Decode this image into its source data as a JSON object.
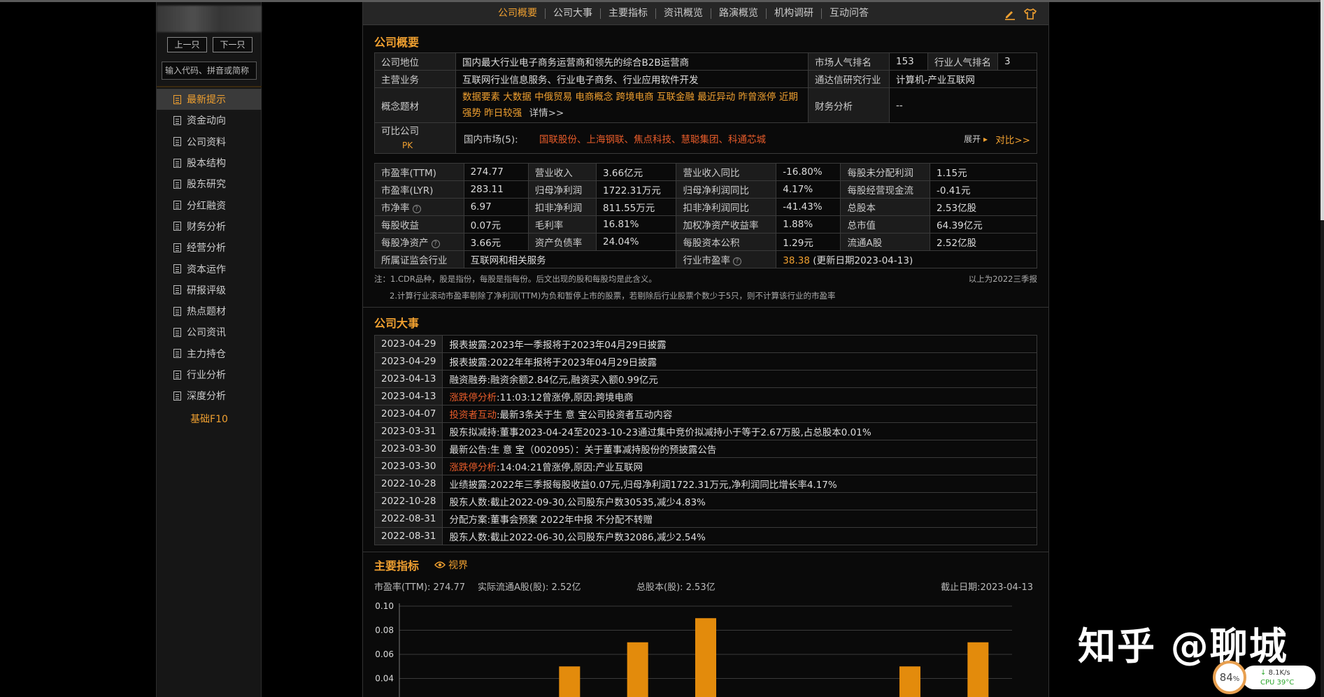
{
  "sidebar": {
    "prev_label": "上一只",
    "next_label": "下一只",
    "search_placeholder": "输入代码、拼音或简称",
    "items": [
      "最新提示",
      "资金动向",
      "公司资料",
      "股本结构",
      "股东研究",
      "分红融资",
      "财务分析",
      "经营分析",
      "资本运作",
      "研报评级",
      "热点题材",
      "公司资讯",
      "主力持仓",
      "行业分析",
      "深度分析"
    ],
    "active_index": 0,
    "basic_f10": "基础F10"
  },
  "topnav": {
    "tabs": [
      "公司概要",
      "公司大事",
      "主要指标",
      "资讯概览",
      "路演概览",
      "机构调研",
      "互动问答"
    ],
    "active_index": 0,
    "icons": [
      "edit-icon",
      "shirt-icon"
    ]
  },
  "profile": {
    "title": "公司概要",
    "position_label": "公司地位",
    "position_value": "国内最大行业电子商务运营商和领先的综合B2B运营商",
    "market_rank_label": "市场人气排名",
    "market_rank_value": "153",
    "industry_rank_label": "行业人气排名",
    "industry_rank_value": "3",
    "business_label": "主营业务",
    "business_value": "互联网行业信息服务、行业电子商务、行业应用软件开发",
    "tdx_industry_label": "通达信研究行业",
    "tdx_industry_value": "计算机-产业互联网",
    "concept_label": "概念题材",
    "concept_line1": "数据要素 大数据 中俄贸易 电商概念 跨境电商 互联金融 最近异动 昨曾涨停 近期",
    "concept_line2": "强势 昨日较强",
    "concept_more": "详情>>",
    "finance_label": "财务分析",
    "finance_value": "--",
    "compare_label": "可比公司",
    "compare_pk": "PK",
    "domestic_label": "国内市场(5):",
    "peers": "国联股份、上海钢联、焦点科技、慧聪集团、科通芯城",
    "expand": "展开",
    "compare_more": "对比>>"
  },
  "metrics": {
    "rows": [
      [
        {
          "l": "市盈率(TTM)",
          "v": "274.77"
        },
        {
          "l": "营业收入",
          "v": "3.66亿元"
        },
        {
          "l": "营业收入同比",
          "v": "-16.80%"
        },
        {
          "l": "每股未分配利润",
          "v": "1.15元"
        }
      ],
      [
        {
          "l": "市盈率(LYR)",
          "v": "283.11"
        },
        {
          "l": "归母净利润",
          "v": "1722.31万元"
        },
        {
          "l": "归母净利润同比",
          "v": "4.17%"
        },
        {
          "l": "每股经营现金流",
          "v": "-0.41元"
        }
      ],
      [
        {
          "l": "市净率",
          "v": "6.97"
        },
        {
          "l": "扣非净利润",
          "v": "811.55万元"
        },
        {
          "l": "扣非净利润同比",
          "v": "-41.43%"
        },
        {
          "l": "总股本",
          "v": "2.53亿股"
        }
      ],
      [
        {
          "l": "每股收益",
          "v": "0.07元"
        },
        {
          "l": "毛利率",
          "v": "16.81%"
        },
        {
          "l": "加权净资产收益率",
          "v": "1.88%"
        },
        {
          "l": "总市值",
          "v": "64.39亿元"
        }
      ],
      [
        {
          "l": "每股净资产",
          "v": "3.66元"
        },
        {
          "l": "资产负债率",
          "v": "24.04%"
        },
        {
          "l": "每股资本公积",
          "v": "1.29元"
        },
        {
          "l": "流通A股",
          "v": "2.52亿股"
        }
      ]
    ],
    "csrc_label": "所属证监会行业",
    "csrc_value": "互联网和相关服务",
    "industry_pe_label": "行业市盈率",
    "industry_pe_value": "38.38",
    "industry_pe_date": "(更新日期2023-04-13)",
    "note1": "注：1.CDR品种，股是指份，每股是指每份。后文出现的股和每股均是此含义。",
    "note_period": "以上为2022三季报",
    "note2": "2.计算行业滚动市盈率剔除了净利润(TTM)为负和暂停上市的股票，若剔除后行业股票个数少于5只，则不计算该行业的市盈率"
  },
  "events": {
    "title": "公司大事",
    "rows": [
      {
        "date": "2023-04-29",
        "tag": "",
        "text": "报表披露:2023年一季报将于2023年04月29日披露"
      },
      {
        "date": "2023-04-29",
        "tag": "",
        "text": "报表披露:2022年年报将于2023年04月29日披露"
      },
      {
        "date": "2023-04-13",
        "tag": "",
        "text": "融资融券:融资余额2.84亿元,融资买入额0.99亿元"
      },
      {
        "date": "2023-04-13",
        "tag": "涨跌停分析",
        "text": ":11:03:12曾涨停,原因:跨境电商"
      },
      {
        "date": "2023-04-07",
        "tag": "投资者互动",
        "text": ":最新3条关于生 意 宝公司投资者互动内容"
      },
      {
        "date": "2023-03-31",
        "tag": "",
        "text": "股东拟减持:董事2023-04-24至2023-10-23通过集中竞价拟减持小于等于2.67万股,占总股本0.01%"
      },
      {
        "date": "2023-03-30",
        "tag": "",
        "text": "最新公告:生 意 宝（002095）：关于董事减持股份的预披露公告"
      },
      {
        "date": "2023-03-30",
        "tag": "涨跌停分析",
        "text": ":14:04:21曾涨停,原因:产业互联网"
      },
      {
        "date": "2022-10-28",
        "tag": "",
        "text": "业绩披露:2022年三季报每股收益0.07元,归母净利润1722.31万元,净利润同比增长率4.17%"
      },
      {
        "date": "2022-10-28",
        "tag": "",
        "text": "股东人数:截止2022-09-30,公司股东户数30535,减少4.83%"
      },
      {
        "date": "2022-08-31",
        "tag": "",
        "text": "分配方案:董事会预案 2022年中报 不分配不转赠"
      },
      {
        "date": "2022-08-31",
        "tag": "",
        "text": "股东人数:截止2022-06-30,公司股东户数32086,减少2.54%"
      }
    ]
  },
  "indicators": {
    "title": "主要指标",
    "view_label": "视界",
    "pe_ttm": "市盈率(TTM): 274.77",
    "float_a": "实际流通A股(股):  2.52亿",
    "total_shares": "总股本(股):  2.53亿",
    "as_of": "截止日期:2023-04-13"
  },
  "chart_data": {
    "type": "bar",
    "y_ticks": [
      "0.10",
      "0.08",
      "0.06",
      "0.04"
    ],
    "ylim": [
      0.04,
      0.1
    ],
    "values": [
      0.04,
      0.04,
      0.05,
      0.07,
      0.09,
      0.04,
      0.04,
      0.05,
      0.07
    ],
    "bar_color": "#e38b0c"
  },
  "watermark": {
    "text": "知乎 @聊城"
  },
  "widget": {
    "percent": "84",
    "percent_unit": "%",
    "net": "8.1K/s",
    "cpu": "CPU 39°C"
  }
}
